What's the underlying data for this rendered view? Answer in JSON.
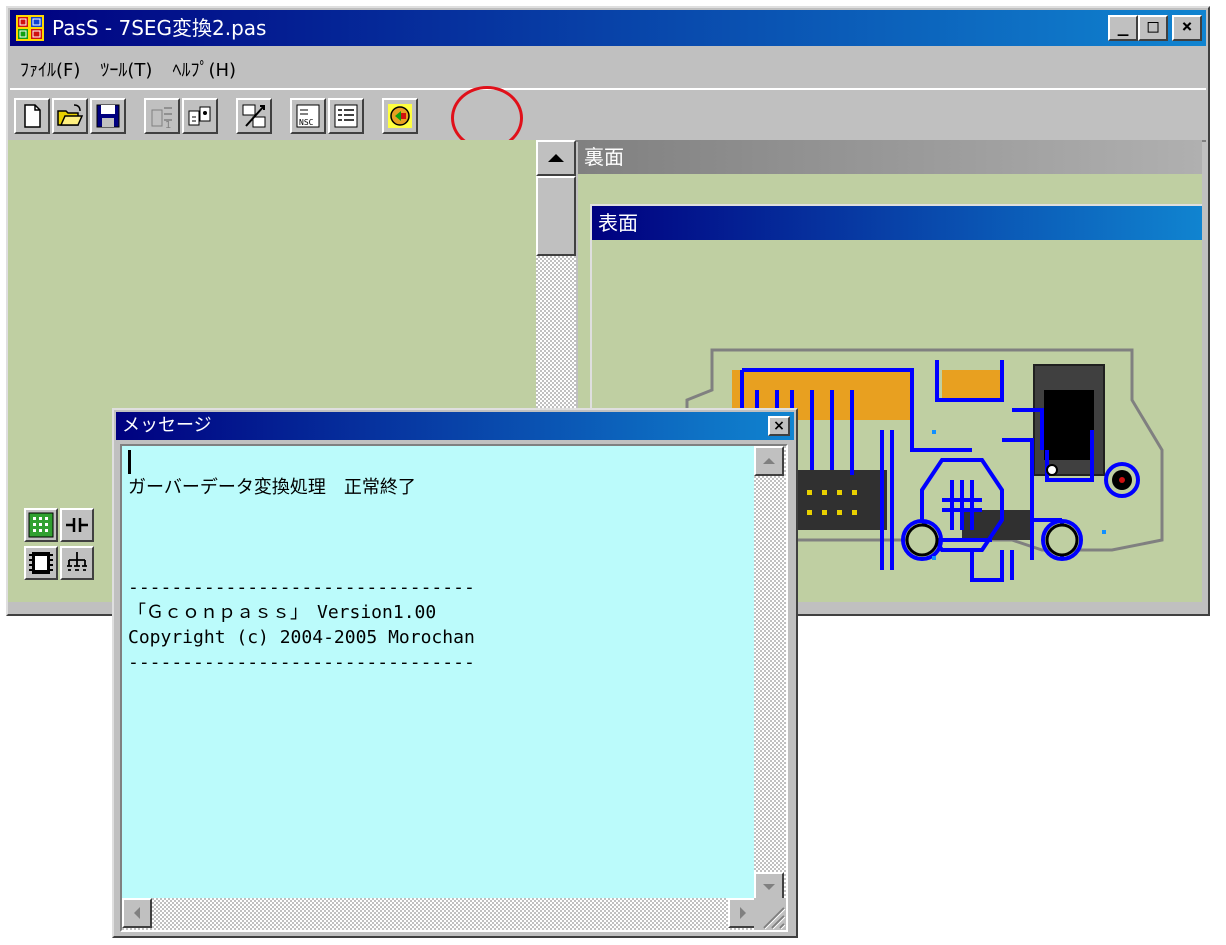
{
  "app": {
    "title": "PasS - 7SEG変換2.pas",
    "window_buttons": {
      "minimize": "_",
      "maximize": "□",
      "close": "×"
    }
  },
  "menu": {
    "items": [
      {
        "label": "ﾌｧｲﾙ(F)"
      },
      {
        "label": "ﾂｰﾙ(T)"
      },
      {
        "label": "ﾍﾙﾌﾟ(H)"
      }
    ]
  },
  "toolbar": {
    "icons": [
      "new-file-icon",
      "open-folder-icon",
      "save-icon",
      "part-add-icon",
      "part-edit-icon",
      "net-route-icon",
      "nsc-icon",
      "list-icon",
      "gerber-convert-icon"
    ]
  },
  "views": {
    "back_title": "裏面",
    "front_title": "表面"
  },
  "message": {
    "title": "メッセージ",
    "close": "×",
    "lines": [
      "ガーバーデータ変換処理　正常終了",
      "",
      "",
      "",
      "--------------------------------",
      "「Ｇｃｏｎｐａｓｓ」　Version1.00",
      "Copyright (c) 2004-2005 Morochan",
      "--------------------------------"
    ]
  },
  "colors": {
    "titlebar": "#000080",
    "board_bg": "#bfcfa2",
    "message_bg": "#bbfbfb",
    "highlight_circle": "#e0101a",
    "trace_blue": "#0000ff",
    "pad_orange": "#e8a020"
  }
}
